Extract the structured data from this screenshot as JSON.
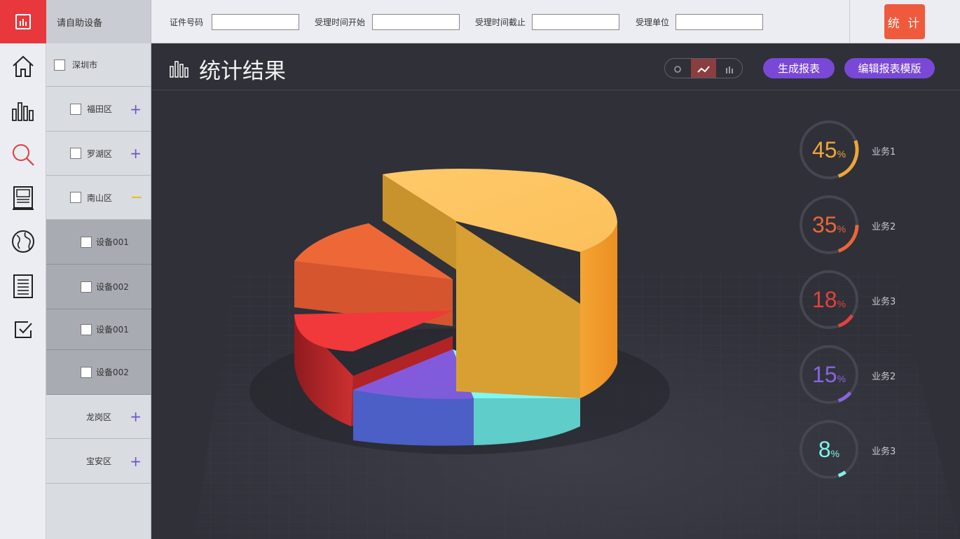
{
  "tree": {
    "header": "请自助设备",
    "nodes": [
      {
        "label": "深圳市"
      },
      {
        "label": "福田区"
      },
      {
        "label": "罗湖区"
      },
      {
        "label": "南山区"
      },
      {
        "label": "设备001"
      },
      {
        "label": "设备002"
      },
      {
        "label": "设备001"
      },
      {
        "label": "设备002"
      },
      {
        "label": "龙岗区"
      },
      {
        "label": "宝安区"
      }
    ]
  },
  "filters": {
    "id_label": "证件号码",
    "start_label": "受理时间开始",
    "end_label": "受理时间截止",
    "unit_label": "受理单位",
    "id_value": "",
    "start_value": "",
    "end_value": "",
    "unit_value": "",
    "submit_label": "统 计"
  },
  "main": {
    "title": "统计结果",
    "generate_label": "生成报表",
    "edit_label": "编辑报表模版",
    "view_modes": [
      "pie",
      "line",
      "bar"
    ],
    "active_view": "line"
  },
  "legend": [
    {
      "value": "45",
      "unit": "%",
      "label": "业务1",
      "color": "#f0a53a"
    },
    {
      "value": "35",
      "unit": "%",
      "label": "业务2",
      "color": "#e8663a"
    },
    {
      "value": "18",
      "unit": "%",
      "label": "业务3",
      "color": "#e2423d"
    },
    {
      "value": "15",
      "unit": "%",
      "label": "业务2",
      "color": "#8b63e0"
    },
    {
      "value": "8",
      "unit": "%",
      "label": "业务3",
      "color": "#7ff2ec"
    }
  ],
  "colors": {
    "brand_red": "#e8383d",
    "accent_purple": "#7a48d6",
    "panel_dark": "#2f3038"
  }
}
